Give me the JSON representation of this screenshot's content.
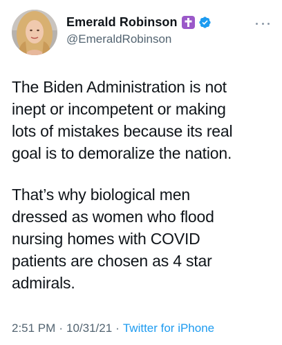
{
  "author": {
    "display_name": "Emerald Robinson",
    "handle": "@EmeraldRobinson",
    "name_emoji": "latin-cross-emoji",
    "verified_icon": "verified-badge-icon",
    "avatar": "profile-photo"
  },
  "menu": {
    "icon": "more-options-icon"
  },
  "tweet": {
    "paragraph_1": "The Biden Administration is not\ninept or incompetent or making\nlots of mistakes because its real\ngoal is to demoralize the nation.",
    "paragraph_2": "That’s why biological men\ndressed as women who flood\nnursing homes with COVID\npatients are chosen as 4 star\nadmirals."
  },
  "meta": {
    "time": "2:51 PM",
    "separator": "·",
    "date": "10/31/21",
    "source": "Twitter for iPhone"
  },
  "colors": {
    "text": "#0f1419",
    "secondary": "#536471",
    "link": "#1d9bf0",
    "verified": "#1d9bf0",
    "emoji_bg": "#9b59c9"
  }
}
